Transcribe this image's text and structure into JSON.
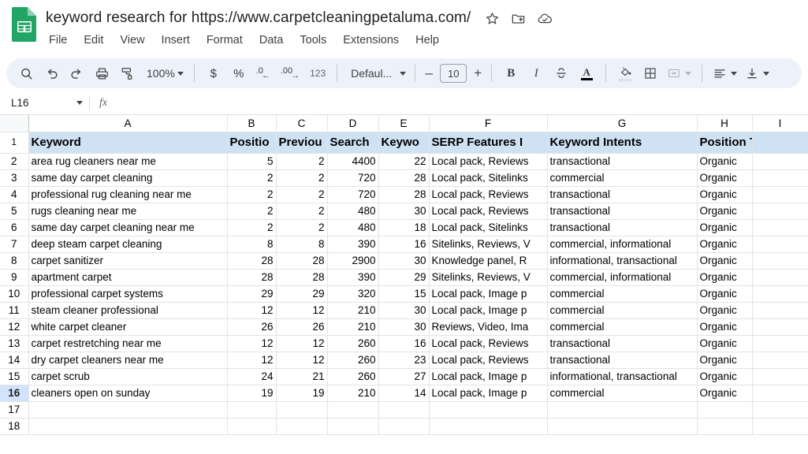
{
  "app": {
    "doc_title": "keyword research for https://www.carpetcleaningpetaluma.com/",
    "logo_name": "google-sheets-logo"
  },
  "title_icons": [
    {
      "name": "star-icon",
      "glyph": "star"
    },
    {
      "name": "move-to-folder-icon",
      "glyph": "folder"
    },
    {
      "name": "cloud-saved-icon",
      "glyph": "cloud"
    }
  ],
  "menu": {
    "items": [
      "File",
      "Edit",
      "View",
      "Insert",
      "Format",
      "Data",
      "Tools",
      "Extensions",
      "Help"
    ]
  },
  "toolbar": {
    "search_label": "search-icon",
    "undo_label": "undo-icon",
    "redo_label": "redo-icon",
    "print_label": "print-icon",
    "paint_format_label": "paint-format-icon",
    "zoom_value": "100%",
    "currency_label": "$",
    "percent_label": "%",
    "decrease_decimal_label": ".0",
    "increase_decimal_label": ".00",
    "more_formats_label": "123",
    "font_name": "Defaul...",
    "font_size": "10",
    "decrease_font": "–",
    "increase_font": "+",
    "bold_label": "B",
    "italic_label": "I",
    "strikethrough_label": "strikethrough-icon",
    "text_color_label": "A",
    "fill_color_label": "fill-color-icon",
    "borders_label": "borders-icon",
    "merge_cells_label": "merge-cells-icon",
    "horizontal_align_label": "horizontal-align-icon",
    "vertical_align_label": "vertical-align-icon"
  },
  "formula_bar": {
    "name_box": "L16",
    "fx_label": "fx",
    "formula_value": ""
  },
  "grid": {
    "column_letters": [
      "A",
      "B",
      "C",
      "D",
      "E",
      "F",
      "G",
      "H",
      "I"
    ],
    "selected_cell": "L16",
    "selected_row": 16,
    "headers": [
      "Keyword",
      "Positio",
      "Previou",
      "Search",
      "Keywo",
      "SERP Features I",
      "Keyword Intents",
      "Position Type",
      ""
    ],
    "rows": [
      {
        "n": 2,
        "cells": [
          "area rug cleaners near me",
          "5",
          "2",
          "4400",
          "22",
          "Local pack, Reviews",
          "transactional",
          "Organic",
          ""
        ]
      },
      {
        "n": 3,
        "cells": [
          "same day carpet cleaning",
          "2",
          "2",
          "720",
          "28",
          "Local pack, Sitelinks",
          "commercial",
          "Organic",
          ""
        ]
      },
      {
        "n": 4,
        "cells": [
          "professional rug cleaning near me",
          "2",
          "2",
          "720",
          "28",
          "Local pack, Reviews",
          "transactional",
          "Organic",
          ""
        ]
      },
      {
        "n": 5,
        "cells": [
          "rugs cleaning near me",
          "2",
          "2",
          "480",
          "30",
          "Local pack, Reviews",
          "transactional",
          "Organic",
          ""
        ]
      },
      {
        "n": 6,
        "cells": [
          "same day carpet cleaning near me",
          "2",
          "2",
          "480",
          "18",
          "Local pack, Sitelinks",
          "transactional",
          "Organic",
          ""
        ]
      },
      {
        "n": 7,
        "cells": [
          "deep steam carpet cleaning",
          "8",
          "8",
          "390",
          "16",
          "Sitelinks, Reviews, V",
          "commercial, informational",
          "Organic",
          ""
        ]
      },
      {
        "n": 8,
        "cells": [
          "carpet sanitizer",
          "28",
          "28",
          "2900",
          "30",
          "Knowledge panel, R",
          "informational, transactional",
          "Organic",
          ""
        ]
      },
      {
        "n": 9,
        "cells": [
          "apartment carpet",
          "28",
          "28",
          "390",
          "29",
          "Sitelinks, Reviews, V",
          "commercial, informational",
          "Organic",
          ""
        ]
      },
      {
        "n": 10,
        "cells": [
          "professional carpet systems",
          "29",
          "29",
          "320",
          "15",
          "Local pack, Image p",
          "commercial",
          "Organic",
          ""
        ]
      },
      {
        "n": 11,
        "cells": [
          "steam cleaner professional",
          "12",
          "12",
          "210",
          "30",
          "Local pack, Image p",
          "commercial",
          "Organic",
          ""
        ]
      },
      {
        "n": 12,
        "cells": [
          "white carpet cleaner",
          "26",
          "26",
          "210",
          "30",
          "Reviews, Video, Ima",
          "commercial",
          "Organic",
          ""
        ]
      },
      {
        "n": 13,
        "cells": [
          "carpet restretching near me",
          "12",
          "12",
          "260",
          "16",
          "Local pack, Reviews",
          "transactional",
          "Organic",
          ""
        ]
      },
      {
        "n": 14,
        "cells": [
          "dry carpet cleaners near me",
          "12",
          "12",
          "260",
          "23",
          "Local pack, Reviews",
          "transactional",
          "Organic",
          ""
        ]
      },
      {
        "n": 15,
        "cells": [
          "carpet scrub",
          "24",
          "21",
          "260",
          "27",
          "Local pack, Image p",
          "informational, transactional",
          "Organic",
          ""
        ]
      },
      {
        "n": 16,
        "cells": [
          "cleaners open on sunday",
          "19",
          "19",
          "210",
          "14",
          "Local pack, Image p",
          "commercial",
          "Organic",
          ""
        ]
      },
      {
        "n": 17,
        "cells": [
          "",
          "",
          "",
          "",
          "",
          "",
          "",
          "",
          ""
        ]
      },
      {
        "n": 18,
        "cells": [
          "",
          "",
          "",
          "",
          "",
          "",
          "",
          "",
          ""
        ]
      }
    ]
  },
  "colors": {
    "header_fill": "#cfe2f3",
    "sheets_green": "#188038",
    "toolbar_bg": "#edf2fa",
    "selection_blue": "#d3e3fd"
  }
}
